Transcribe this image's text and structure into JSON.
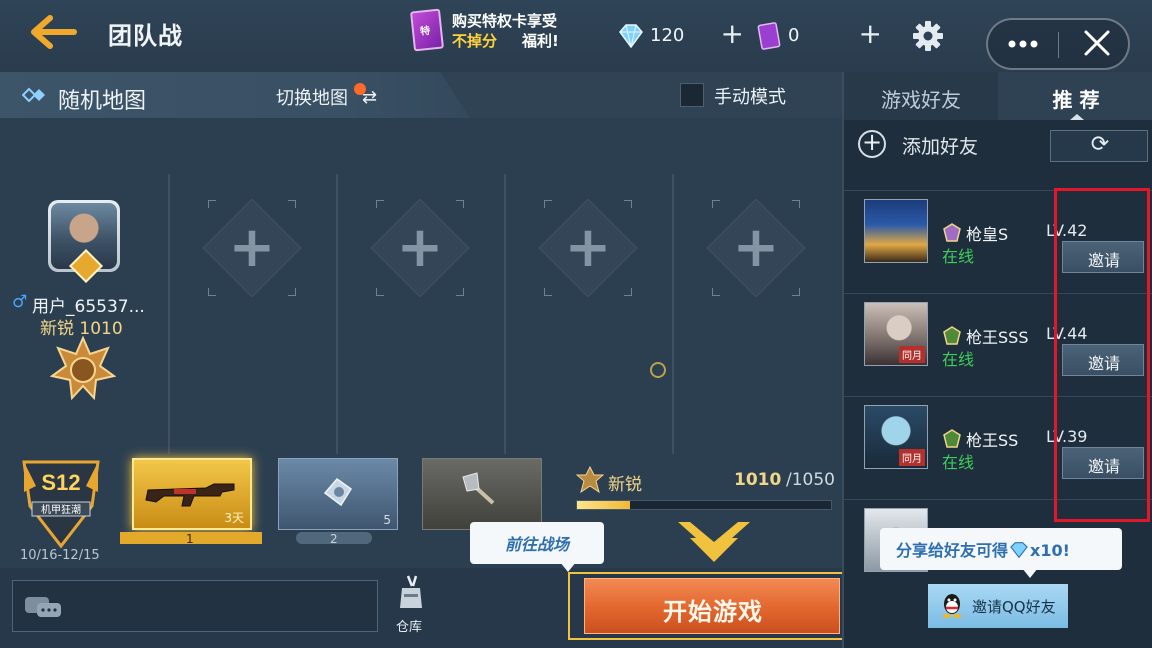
{
  "header": {
    "title": "团队战",
    "promo": {
      "line1": "购买特权卡享受",
      "line2_highlight": "不掉分",
      "line2_rest": "福利!",
      "card_text": "特"
    },
    "diamonds": "120",
    "tickets": "0",
    "plus": "+"
  },
  "mapbar": {
    "map_name": "随机地图",
    "switch_label": "切换地图",
    "switch_arrows": "⇄",
    "manual_mode_label": "手动模式",
    "manual_mode_checked": false
  },
  "player": {
    "gender_symbol": "♂",
    "name": "用户_65537...",
    "rank_text": "新锐 1010"
  },
  "slots": [
    "+",
    "+",
    "+",
    "+"
  ],
  "season": {
    "label": "S12",
    "sub": "机甲狂潮",
    "dates": "10/16-12/15"
  },
  "weapons": [
    {
      "count": "3天",
      "page": "1"
    },
    {
      "count": "5",
      "page": "2"
    },
    {
      "count": "",
      "page": ""
    }
  ],
  "progress": {
    "rank": "新锐",
    "value": "1010",
    "max": "/1050",
    "fraction": 0.21
  },
  "actions": {
    "battlefield_tip": "前往战场",
    "start_label": "开始游戏",
    "armory_label": "仓库"
  },
  "panel": {
    "tab_friends": "游戏好友",
    "tab_recommend": "推 荐",
    "add_friend": "添加好友",
    "refresh_icon": "⟳",
    "friends": [
      {
        "name": "枪皇S",
        "level": "LV.42",
        "status": "在线",
        "invite": "邀请",
        "tag": ""
      },
      {
        "name": "枪王SSS",
        "level": "LV.44",
        "status": "在线",
        "invite": "邀请",
        "tag": "同月"
      },
      {
        "name": "枪王SS",
        "level": "LV.39",
        "status": "在线",
        "invite": "邀请",
        "tag": "同月"
      }
    ],
    "share_tip": "分享给好友可得",
    "share_reward": "x10!",
    "qq_invite": "邀请QQ好友"
  },
  "colors": {
    "accent_gold": "#f1c23e",
    "start_orange": "#e2662e",
    "online_green": "#3ccf5a",
    "highlight_red": "#e3172a"
  },
  "icons": [
    "back-arrow-icon",
    "gear-icon",
    "more-icon",
    "close-icon",
    "diamond-icon",
    "ticket-icon",
    "plus-icon",
    "swap-icon",
    "refresh-icon",
    "chat-icon",
    "armory-icon",
    "qq-icon",
    "rank-medal-icon"
  ]
}
